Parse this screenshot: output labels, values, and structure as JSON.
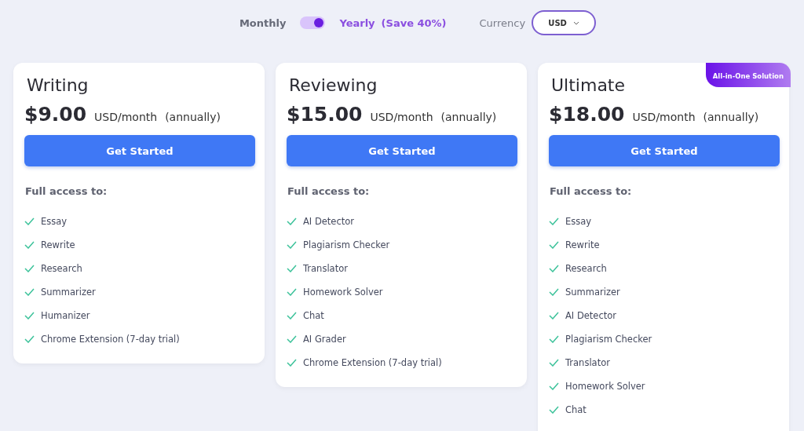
{
  "billing": {
    "monthly_label": "Monthly",
    "yearly_label": "Yearly",
    "yearly_on": true,
    "savings": "(Save 40%)",
    "currency_label": "Currency",
    "currency": "USD"
  },
  "plans": [
    {
      "name": "Writing",
      "price": "$9.00",
      "unit": "USD/month",
      "period": "(annually)",
      "button": "Get Started",
      "features_heading": "Full access to:",
      "features": [
        "Essay",
        "Rewrite",
        "Research",
        "Summarizer",
        "Humanizer",
        "Chrome Extension (7-day trial)"
      ]
    },
    {
      "name": "Reviewing",
      "price": "$15.00",
      "unit": "USD/month",
      "period": "(annually)",
      "button": "Get Started",
      "features_heading": "Full access to:",
      "features": [
        "AI Detector",
        "Plagiarism Checker",
        "Translator",
        "Homework Solver",
        "Chat",
        "AI Grader",
        "Chrome Extension (7-day trial)"
      ]
    },
    {
      "name": "Ultimate",
      "price": "$18.00",
      "unit": "USD/month",
      "period": "(annually)",
      "button": "Get Started",
      "badge": "All-in-One Solution",
      "features_heading": "Full access to:",
      "features": [
        "Essay",
        "Rewrite",
        "Research",
        "Summarizer",
        "AI Detector",
        "Plagiarism Checker",
        "Translator",
        "Homework Solver",
        "Chat"
      ]
    }
  ]
}
